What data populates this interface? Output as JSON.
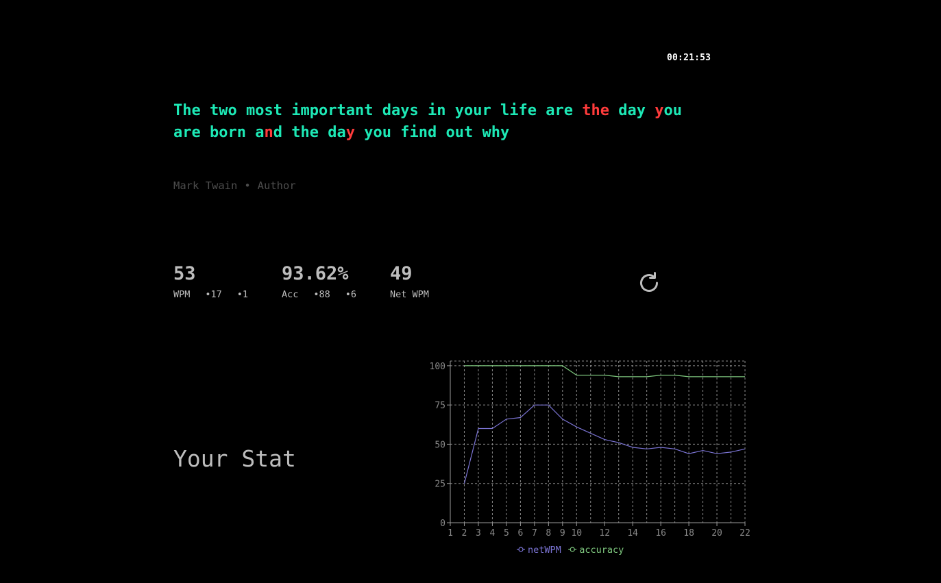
{
  "timer": "00:21:53",
  "quote": {
    "words": [
      {
        "text": "The",
        "wrong": []
      },
      {
        "text": "two",
        "wrong": []
      },
      {
        "text": "most",
        "wrong": []
      },
      {
        "text": "important",
        "wrong": []
      },
      {
        "text": "days",
        "wrong": []
      },
      {
        "text": "in",
        "wrong": []
      },
      {
        "text": "your",
        "wrong": []
      },
      {
        "text": "life",
        "wrong": []
      },
      {
        "text": "are",
        "wrong": []
      },
      {
        "text": "the",
        "wrong": [
          0,
          1,
          2
        ]
      },
      {
        "text": "day",
        "wrong": []
      },
      {
        "text": "you",
        "wrong": [
          0
        ]
      },
      {
        "text": "are",
        "wrong": []
      },
      {
        "text": "born",
        "wrong": []
      },
      {
        "text": "and",
        "wrong": [
          1
        ]
      },
      {
        "text": "the",
        "wrong": []
      },
      {
        "text": "day",
        "wrong": [
          2
        ]
      },
      {
        "text": "you",
        "wrong": []
      },
      {
        "text": "find",
        "wrong": []
      },
      {
        "text": "out",
        "wrong": []
      },
      {
        "text": "why",
        "wrong": []
      }
    ]
  },
  "attribution": {
    "author": "Mark Twain",
    "separator": "•",
    "role": "Author"
  },
  "stats": {
    "wpm": {
      "value": "53",
      "label": "WPM",
      "extra1": "•17",
      "extra2": "•1"
    },
    "acc": {
      "value": "93.62%",
      "label": "Acc",
      "extra1": "•88",
      "extra2": "•6"
    },
    "net": {
      "value": "49",
      "label": "Net WPM"
    }
  },
  "restart_icon": "refresh-icon",
  "your_stat_label": "Your Stat",
  "colors": {
    "correct": "#1de9b6",
    "wrong": "#ff3b3b",
    "netWPM": "#7b74d4",
    "accuracy": "#7fc97f"
  },
  "chart_data": {
    "type": "line",
    "x": [
      1,
      2,
      3,
      4,
      5,
      6,
      7,
      8,
      9,
      10,
      11,
      12,
      13,
      14,
      15,
      16,
      17,
      18,
      19,
      20,
      21,
      22
    ],
    "x_ticks": [
      1,
      2,
      3,
      4,
      5,
      6,
      7,
      8,
      9,
      10,
      12,
      14,
      16,
      18,
      20,
      22
    ],
    "y_ticks": [
      0,
      25,
      50,
      75,
      100
    ],
    "ylim": [
      0,
      103
    ],
    "grid": true,
    "legend_position": "bottom",
    "series": [
      {
        "name": "netWPM",
        "x": [
          2,
          3,
          4,
          5,
          6,
          7,
          8,
          9,
          10,
          11,
          12,
          13,
          14,
          15,
          16,
          17,
          18,
          19,
          20,
          21,
          22
        ],
        "values": [
          25,
          60,
          60,
          66,
          67,
          75,
          75,
          66,
          61,
          57,
          53,
          51,
          48,
          47,
          48,
          47,
          44,
          46,
          44,
          45,
          47
        ]
      },
      {
        "name": "accuracy",
        "x": [
          2,
          3,
          4,
          5,
          6,
          7,
          8,
          9,
          10,
          11,
          12,
          13,
          14,
          15,
          16,
          17,
          18,
          19,
          20,
          21,
          22
        ],
        "values": [
          100,
          100,
          100,
          100,
          100,
          100,
          100,
          100,
          94,
          94,
          94,
          93,
          93,
          93,
          94,
          94,
          93,
          93,
          93,
          93,
          93
        ]
      }
    ]
  }
}
